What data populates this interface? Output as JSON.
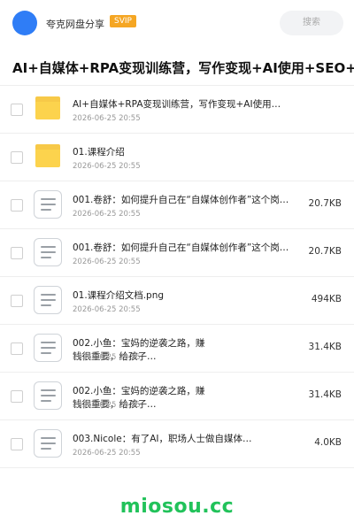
{
  "header": {
    "user_name": "夸克网盘分享",
    "badge": "SVIP",
    "search_label": "搜索"
  },
  "folder_title": "AI+自媒体+RPA变现训练营，写作变现+AI使用+SEO+多…",
  "files": [
    {
      "name": "AI+自媒体+RPA变现训练营，写作变现+AI使用…",
      "date": "2026-06-25 20:55",
      "size": "",
      "icon": "folder-icon"
    },
    {
      "name": "01.课程介绍",
      "date": "2026-06-25 20:55",
      "size": "",
      "icon": "folder-icon"
    },
    {
      "name": "001.卷舒：如何提升自己在“自媒体创作者”这个岗…",
      "date": "2026-06-25 20:55",
      "size": "20.7KB",
      "icon": "document-icon"
    },
    {
      "name": "001.卷舒：如何提升自己在“自媒体创作者”这个岗…",
      "date": "2026-06-25 20:55",
      "size": "20.7KB",
      "icon": "document-icon"
    },
    {
      "name": "01.课程介绍文档.png",
      "date": "2026-06-25 20:55",
      "size": "494KB",
      "icon": "document-icon"
    },
    {
      "name": "002.小鱼：宝妈的逆袭之路，赚钱很重要，给孩子…",
      "date": "2026-06-25 20:55",
      "size": "31.4KB",
      "icon": "document-icon"
    },
    {
      "name": "002.小鱼：宝妈的逆袭之路，赚钱很重要，给孩子…",
      "date": "2026-06-25 20:55",
      "size": "31.4KB",
      "icon": "document-icon"
    },
    {
      "name": "003.Nicole：有了AI，职场人士做自媒体…",
      "date": "2026-06-25 20:55",
      "size": "4.0KB",
      "icon": "document-icon"
    }
  ],
  "watermark": "miosou.cc",
  "colors": {
    "avatar": "#2f7df6",
    "svip_badge": "#f5a623",
    "folder": "#fcd34d",
    "watermark": "#21c25a"
  }
}
